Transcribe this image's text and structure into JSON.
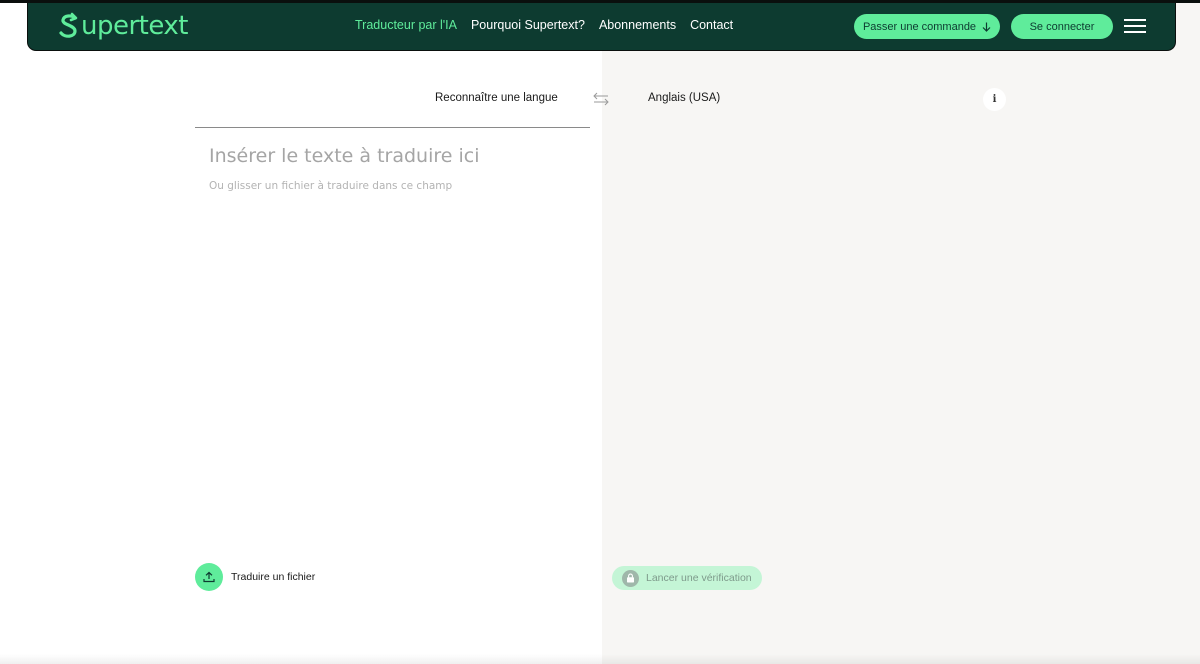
{
  "header": {
    "logo_text": "upertext",
    "nav": [
      {
        "label": "Traducteur par l'IA",
        "active": true
      },
      {
        "label": "Pourquoi Supertext?",
        "active": false
      },
      {
        "label": "Abonnements",
        "active": false
      },
      {
        "label": "Contact",
        "active": false
      }
    ],
    "order_button": "Passer une commande",
    "login_button": "Se connecter",
    "menu_icon": "hamburger-icon"
  },
  "translator": {
    "source_language": "Reconnaître une langue",
    "swap_icon": "swap-arrows-icon",
    "target_language": "Anglais (USA)",
    "info_icon": "info-icon",
    "info_glyph": "i",
    "placeholder": "Insérer le texte à traduire ici",
    "placeholder_hint": "Ou glisser un fichier à traduire dans ce champ",
    "upload_label": "Traduire un fichier",
    "verify_button": "Lancer une vérification"
  },
  "colors": {
    "header_bg": "#0d3b30",
    "accent": "#5fec9b",
    "right_pane_bg": "#f7f6f4",
    "verify_bg": "#c4f5d6"
  }
}
